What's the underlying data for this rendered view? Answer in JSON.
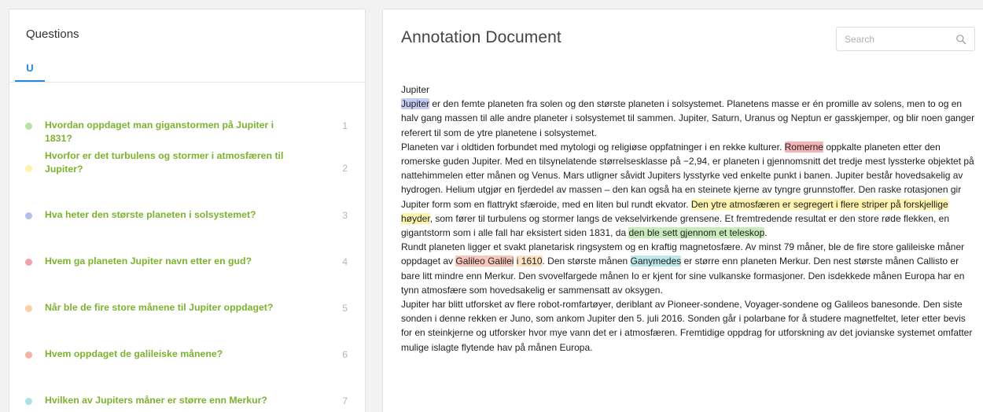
{
  "colors": {
    "question_text": "#7cb32c",
    "tab_accent": "#1e88e5"
  },
  "questions_panel": {
    "title": "Questions",
    "tab_label": "U",
    "items": [
      {
        "text": "Hvordan oppdaget man giganstormen på Jupiter i 1831?",
        "number": "1",
        "dot_color": "#b6e3a4"
      },
      {
        "text": "Hvorfor er det turbulens og stormer i atmosfæren til Jupiter?",
        "number": "2",
        "dot_color": "#fff3a6"
      },
      {
        "text": "Hva heter den største planeten i solsystemet?",
        "number": "3",
        "dot_color": "#b4bff0"
      },
      {
        "text": "Hvem ga planeten Jupiter navn etter en gud?",
        "number": "4",
        "dot_color": "#f0a2a6"
      },
      {
        "text": "Når ble de fire store månene til Jupiter oppdaget?",
        "number": "5",
        "dot_color": "#fcd0a6"
      },
      {
        "text": "Hvem oppdaget de galileiske månene?",
        "number": "6",
        "dot_color": "#f6b2a4"
      },
      {
        "text": "Hvilken av Jupiters måner er større enn Merkur?",
        "number": "7",
        "dot_color": "#a6e3e6"
      }
    ]
  },
  "document": {
    "title": "Annotation Document",
    "search_placeholder": "Search",
    "search_icon": "magnifier-icon",
    "heading": "Jupiter",
    "paragraphs": [
      [
        {
          "t": "Jupiter",
          "hl": "#c6cdf4"
        },
        {
          "t": " er den femte planeten fra solen og den største planeten i solsystemet. Planetens masse er én promille av solens, men to og en halv gang massen til alle andre planeter i solsystemet til sammen. Jupiter, Saturn, Uranus og Neptun er gasskjemper, og blir noen ganger referert til som de ytre planetene i solsystemet."
        }
      ],
      [
        {
          "t": "Planeten var i oldtiden forbundet med mytologi og religiøse oppfatninger i en rekke kulturer. "
        },
        {
          "t": "Romerne",
          "hl": "#f6b3b6"
        },
        {
          "t": " oppkalte planeten etter den romerske guden Jupiter. Med en tilsynelatende størrelsesklasse på −2,94, er planeten i gjennomsnitt det tredje mest lyssterke objektet på nattehimmelen etter månen og Venus. Mars utligner såvidt Jupiters lysstyrke ved enkelte punkt i banen. Jupiter består hovedsakelig av hydrogen. Helium utgjør en fjerdedel av massen – den kan også ha en steinete kjerne av tyngre grunnstoffer. Den raske rotasjonen gir Jupiter form som en flattrykt sfæroide, med en liten bul rundt ekvator. "
        },
        {
          "t": "Den ytre atmosfæren er segregert i flere striper på forskjellige høyder",
          "hl": "#fff4ae"
        },
        {
          "t": ", som fører til turbulens og stormer langs de vekselvirkende grensene. Et fremtredende resultat er den store røde flekken, en gigantstorm som i alle fall har eksistert siden 1831, da "
        },
        {
          "t": "den ble sett gjennom et teleskop",
          "hl": "#c8ecbc"
        },
        {
          "t": "."
        }
      ],
      [
        {
          "t": "Rundt planeten ligger et svakt planetarisk ringsystem og en kraftig magnetosfære. Av minst 79 måner, ble de fire store galileiske måner oppdaget av "
        },
        {
          "t": "Galileo Galilei",
          "hl": "#f8c7bb"
        },
        {
          "t": " "
        },
        {
          "t": "i 1610",
          "hl": "#fde0c1"
        },
        {
          "t": ". Den største månen "
        },
        {
          "t": "Ganymedes",
          "hl": "#bde8ea"
        },
        {
          "t": " er større enn planeten Merkur. Den nest største månen Callisto er bare litt mindre enn Merkur. Den svovelfargede månen Io er kjent for sine vulkanske formasjoner. Den isdekkede månen Europa har en tynn atmosfære som hovedsakelig er sammensatt av oksygen."
        }
      ],
      [
        {
          "t": "Jupiter har blitt utforsket av flere robot-romfartøyer, deriblant av Pioneer-sondene, Voyager-sondene og Galileos banesonde. Den siste sonden i denne rekken er Juno, som ankom Jupiter den 5. juli 2016. Sonden går i polarbane for å studere magnetfeltet, leter etter bevis for en steinkjerne og utforsker hvor mye vann det er i atmosfæren. Fremtidige oppdrag for utforskning av det jovianske systemet omfatter mulige islagte flytende hav på månen Europa."
        }
      ]
    ]
  }
}
